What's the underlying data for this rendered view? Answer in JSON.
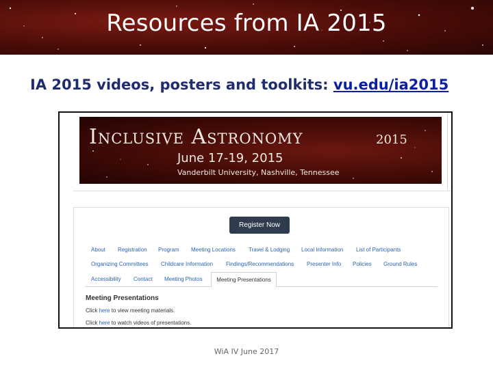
{
  "slide": {
    "title": "Resources from IA 2015",
    "subtitle_prefix": "IA 2015 videos, posters and toolkits: ",
    "subtitle_link": "vu.edu/ia2015",
    "footer": "WiA IV June 2017"
  },
  "site": {
    "banner": {
      "name": "Inclusive Astronomy",
      "year": "2015",
      "dates": "June 17-19, 2015",
      "location": "Vanderbilt University, Nashville, Tennessee"
    },
    "register_label": "Register Now",
    "nav_row1": [
      "About",
      "Registration",
      "Program",
      "Meeting Locations",
      "Travel & Lodging",
      "Local Information",
      "List of Participants"
    ],
    "nav_row2": [
      "Organizing Committees",
      "Childcare Information",
      "Findings/Recommendations",
      "Presenter Info",
      "Policies",
      "Ground Rules"
    ],
    "nav_row3": [
      "Accessibility",
      "Contact",
      "Meeting Photos",
      "Meeting Presentations"
    ],
    "section_title": "Meeting Presentations",
    "line1": {
      "pre": "Click ",
      "link": "here",
      "post": " to view meeting materials."
    },
    "line2": {
      "pre": "Click ",
      "link": "here",
      "post": " to watch videos of presentations."
    }
  }
}
